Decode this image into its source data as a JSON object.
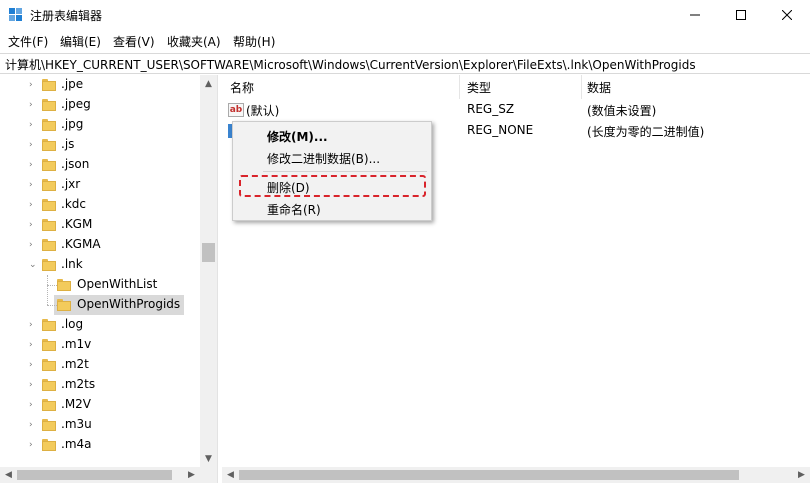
{
  "window": {
    "title": "注册表编辑器",
    "minimize_glyph": "—",
    "maximize_glyph": "☐",
    "close_glyph": "✕"
  },
  "menu": [
    "文件(F)",
    "编辑(E)",
    "查看(V)",
    "收藏夹(A)",
    "帮助(H)"
  ],
  "address": "计算机\\HKEY_CURRENT_USER\\SOFTWARE\\Microsoft\\Windows\\CurrentVersion\\Explorer\\FileExts\\.lnk\\OpenWithProgids",
  "tree": {
    "items": [
      {
        "label": ".jpe",
        "expander": "›"
      },
      {
        "label": ".jpeg",
        "expander": "›"
      },
      {
        "label": ".jpg",
        "expander": "›"
      },
      {
        "label": ".js",
        "expander": "›"
      },
      {
        "label": ".json",
        "expander": "›"
      },
      {
        "label": ".jxr",
        "expander": "›"
      },
      {
        "label": ".kdc",
        "expander": "›"
      },
      {
        "label": ".KGM",
        "expander": "›"
      },
      {
        "label": ".KGMA",
        "expander": "›"
      },
      {
        "label": ".lnk",
        "expander": "⌄"
      },
      {
        "label": "OpenWithList",
        "expander": ""
      },
      {
        "label": "OpenWithProgids",
        "expander": ""
      },
      {
        "label": ".log",
        "expander": "›"
      },
      {
        "label": ".m1v",
        "expander": "›"
      },
      {
        "label": ".m2t",
        "expander": "›"
      },
      {
        "label": ".m2ts",
        "expander": "›"
      },
      {
        "label": ".M2V",
        "expander": "›"
      },
      {
        "label": ".m3u",
        "expander": "›"
      },
      {
        "label": ".m4a",
        "expander": "›"
      }
    ],
    "selected": "OpenWithProgids"
  },
  "list": {
    "columns": [
      "名称",
      "类型",
      "数据"
    ],
    "rows": [
      {
        "name": "(默认)",
        "type": "REG_SZ",
        "data": "(数值未设置)",
        "icon": "ab-icon"
      },
      {
        "name": "",
        "type": "REG_NONE",
        "data": "(长度为零的二进制值)",
        "icon": "binary-icon"
      }
    ]
  },
  "context_menu": {
    "items": [
      "修改(M)...",
      "修改二进制数据(B)...",
      "删除(D)",
      "重命名(R)"
    ],
    "highlighted": "删除(D)",
    "highlight_color": "#d9242b"
  },
  "scroll": {
    "up": "▲",
    "down": "▼",
    "left": "◀",
    "right": "▶"
  },
  "icons": {
    "ab": "ab"
  }
}
